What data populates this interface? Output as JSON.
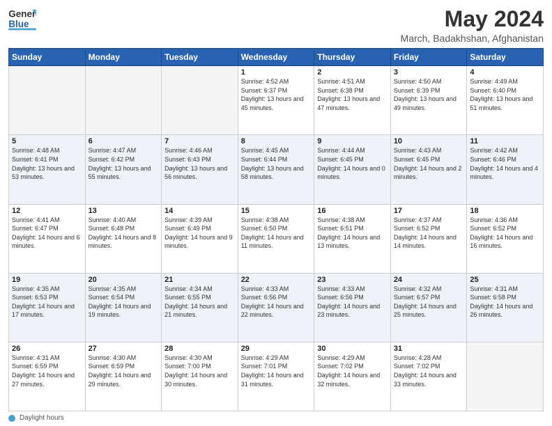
{
  "header": {
    "logo_general": "General",
    "logo_blue": "Blue",
    "main_title": "May 2024",
    "subtitle": "March, Badakhshan, Afghanistan"
  },
  "days_of_week": [
    "Sunday",
    "Monday",
    "Tuesday",
    "Wednesday",
    "Thursday",
    "Friday",
    "Saturday"
  ],
  "weeks": [
    [
      {
        "day": "",
        "sunrise": "",
        "sunset": "",
        "daylight": "",
        "empty": true
      },
      {
        "day": "",
        "sunrise": "",
        "sunset": "",
        "daylight": "",
        "empty": true
      },
      {
        "day": "",
        "sunrise": "",
        "sunset": "",
        "daylight": "",
        "empty": true
      },
      {
        "day": "1",
        "sunrise": "Sunrise: 4:52 AM",
        "sunset": "Sunset: 6:37 PM",
        "daylight": "Daylight: 13 hours and 45 minutes.",
        "empty": false
      },
      {
        "day": "2",
        "sunrise": "Sunrise: 4:51 AM",
        "sunset": "Sunset: 6:38 PM",
        "daylight": "Daylight: 13 hours and 47 minutes.",
        "empty": false
      },
      {
        "day": "3",
        "sunrise": "Sunrise: 4:50 AM",
        "sunset": "Sunset: 6:39 PM",
        "daylight": "Daylight: 13 hours and 49 minutes.",
        "empty": false
      },
      {
        "day": "4",
        "sunrise": "Sunrise: 4:49 AM",
        "sunset": "Sunset: 6:40 PM",
        "daylight": "Daylight: 13 hours and 51 minutes.",
        "empty": false
      }
    ],
    [
      {
        "day": "5",
        "sunrise": "Sunrise: 4:48 AM",
        "sunset": "Sunset: 6:41 PM",
        "daylight": "Daylight: 13 hours and 53 minutes.",
        "empty": false
      },
      {
        "day": "6",
        "sunrise": "Sunrise: 4:47 AM",
        "sunset": "Sunset: 6:42 PM",
        "daylight": "Daylight: 13 hours and 55 minutes.",
        "empty": false
      },
      {
        "day": "7",
        "sunrise": "Sunrise: 4:46 AM",
        "sunset": "Sunset: 6:43 PM",
        "daylight": "Daylight: 13 hours and 56 minutes.",
        "empty": false
      },
      {
        "day": "8",
        "sunrise": "Sunrise: 4:45 AM",
        "sunset": "Sunset: 6:44 PM",
        "daylight": "Daylight: 13 hours and 58 minutes.",
        "empty": false
      },
      {
        "day": "9",
        "sunrise": "Sunrise: 4:44 AM",
        "sunset": "Sunset: 6:45 PM",
        "daylight": "Daylight: 14 hours and 0 minutes.",
        "empty": false
      },
      {
        "day": "10",
        "sunrise": "Sunrise: 4:43 AM",
        "sunset": "Sunset: 6:45 PM",
        "daylight": "Daylight: 14 hours and 2 minutes.",
        "empty": false
      },
      {
        "day": "11",
        "sunrise": "Sunrise: 4:42 AM",
        "sunset": "Sunset: 6:46 PM",
        "daylight": "Daylight: 14 hours and 4 minutes.",
        "empty": false
      }
    ],
    [
      {
        "day": "12",
        "sunrise": "Sunrise: 4:41 AM",
        "sunset": "Sunset: 6:47 PM",
        "daylight": "Daylight: 14 hours and 6 minutes.",
        "empty": false
      },
      {
        "day": "13",
        "sunrise": "Sunrise: 4:40 AM",
        "sunset": "Sunset: 6:48 PM",
        "daylight": "Daylight: 14 hours and 8 minutes.",
        "empty": false
      },
      {
        "day": "14",
        "sunrise": "Sunrise: 4:39 AM",
        "sunset": "Sunset: 6:49 PM",
        "daylight": "Daylight: 14 hours and 9 minutes.",
        "empty": false
      },
      {
        "day": "15",
        "sunrise": "Sunrise: 4:38 AM",
        "sunset": "Sunset: 6:50 PM",
        "daylight": "Daylight: 14 hours and 11 minutes.",
        "empty": false
      },
      {
        "day": "16",
        "sunrise": "Sunrise: 4:38 AM",
        "sunset": "Sunset: 6:51 PM",
        "daylight": "Daylight: 14 hours and 13 minutes.",
        "empty": false
      },
      {
        "day": "17",
        "sunrise": "Sunrise: 4:37 AM",
        "sunset": "Sunset: 6:52 PM",
        "daylight": "Daylight: 14 hours and 14 minutes.",
        "empty": false
      },
      {
        "day": "18",
        "sunrise": "Sunrise: 4:36 AM",
        "sunset": "Sunset: 6:52 PM",
        "daylight": "Daylight: 14 hours and 16 minutes.",
        "empty": false
      }
    ],
    [
      {
        "day": "19",
        "sunrise": "Sunrise: 4:35 AM",
        "sunset": "Sunset: 6:53 PM",
        "daylight": "Daylight: 14 hours and 17 minutes.",
        "empty": false
      },
      {
        "day": "20",
        "sunrise": "Sunrise: 4:35 AM",
        "sunset": "Sunset: 6:54 PM",
        "daylight": "Daylight: 14 hours and 19 minutes.",
        "empty": false
      },
      {
        "day": "21",
        "sunrise": "Sunrise: 4:34 AM",
        "sunset": "Sunset: 6:55 PM",
        "daylight": "Daylight: 14 hours and 21 minutes.",
        "empty": false
      },
      {
        "day": "22",
        "sunrise": "Sunrise: 4:33 AM",
        "sunset": "Sunset: 6:56 PM",
        "daylight": "Daylight: 14 hours and 22 minutes.",
        "empty": false
      },
      {
        "day": "23",
        "sunrise": "Sunrise: 4:33 AM",
        "sunset": "Sunset: 6:56 PM",
        "daylight": "Daylight: 14 hours and 23 minutes.",
        "empty": false
      },
      {
        "day": "24",
        "sunrise": "Sunrise: 4:32 AM",
        "sunset": "Sunset: 6:57 PM",
        "daylight": "Daylight: 14 hours and 25 minutes.",
        "empty": false
      },
      {
        "day": "25",
        "sunrise": "Sunrise: 4:31 AM",
        "sunset": "Sunset: 6:58 PM",
        "daylight": "Daylight: 14 hours and 26 minutes.",
        "empty": false
      }
    ],
    [
      {
        "day": "26",
        "sunrise": "Sunrise: 4:31 AM",
        "sunset": "Sunset: 6:59 PM",
        "daylight": "Daylight: 14 hours and 27 minutes.",
        "empty": false
      },
      {
        "day": "27",
        "sunrise": "Sunrise: 4:30 AM",
        "sunset": "Sunset: 6:59 PM",
        "daylight": "Daylight: 14 hours and 29 minutes.",
        "empty": false
      },
      {
        "day": "28",
        "sunrise": "Sunrise: 4:30 AM",
        "sunset": "Sunset: 7:00 PM",
        "daylight": "Daylight: 14 hours and 30 minutes.",
        "empty": false
      },
      {
        "day": "29",
        "sunrise": "Sunrise: 4:29 AM",
        "sunset": "Sunset: 7:01 PM",
        "daylight": "Daylight: 14 hours and 31 minutes.",
        "empty": false
      },
      {
        "day": "30",
        "sunrise": "Sunrise: 4:29 AM",
        "sunset": "Sunset: 7:02 PM",
        "daylight": "Daylight: 14 hours and 32 minutes.",
        "empty": false
      },
      {
        "day": "31",
        "sunrise": "Sunrise: 4:28 AM",
        "sunset": "Sunset: 7:02 PM",
        "daylight": "Daylight: 14 hours and 33 minutes.",
        "empty": false
      },
      {
        "day": "",
        "sunrise": "",
        "sunset": "",
        "daylight": "",
        "empty": true
      }
    ]
  ],
  "footer": {
    "daylight_hours_label": "Daylight hours"
  }
}
